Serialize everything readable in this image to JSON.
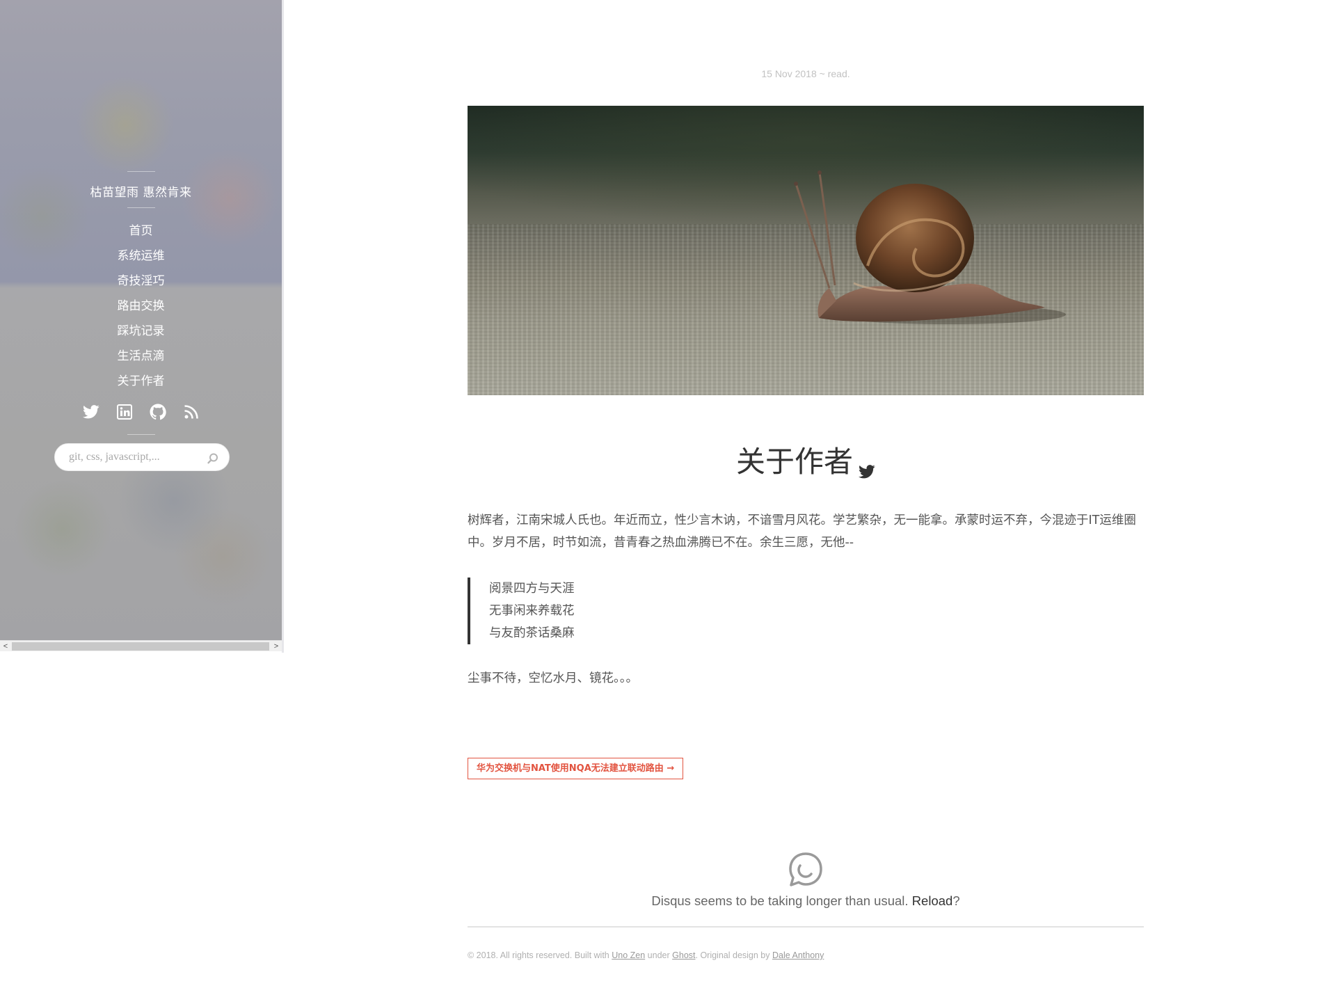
{
  "sidebar": {
    "blog_title": "枯苗望雨 惠然肯来",
    "nav": [
      {
        "label": "首页"
      },
      {
        "label": "系统运维"
      },
      {
        "label": "奇技淫巧"
      },
      {
        "label": "路由交换"
      },
      {
        "label": "踩坑记录"
      },
      {
        "label": "生活点滴"
      },
      {
        "label": "关于作者"
      }
    ],
    "social": [
      "twitter-icon",
      "linkedin-icon",
      "github-icon",
      "rss-icon"
    ],
    "search": {
      "placeholder": "git, css, javascript,..."
    },
    "scrollbar": {
      "left_arrow": "<",
      "right_arrow": ">"
    }
  },
  "post": {
    "meta": "15 Nov 2018 ~ read.",
    "title": "关于作者",
    "intro": "树辉者，江南宋城人氏也。年近而立，性少言木讷，不谙雪月风花。学艺繁杂，无一能拿。承蒙时运不弃，今混迹于IT运维圈中。岁月不居，时节如流，昔青春之热血沸腾已不在。余生三愿，无他--",
    "quote_lines": [
      "阅景四方与天涯",
      "无事闲来养载花",
      "与友酌茶话桑麻"
    ],
    "closing": "尘事不待，空忆水月、镜花。。。",
    "next_post": "华为交换机与NAT使用NQA无法建立联动路由 →"
  },
  "disqus": {
    "message": "Disqus seems to be taking longer than usual.",
    "reload": "Reload",
    "suffix": "?"
  },
  "footer": {
    "prefix": "© 2018. All rights reserved. Built with",
    "theme_link": "Uno Zen",
    "under": "under",
    "ghost_link": "Ghost",
    "design": ". Original design by",
    "designer_link": "Dale Anthony"
  },
  "colors": {
    "accent": "#e25440",
    "text": "#555555",
    "heading": "#333333"
  }
}
